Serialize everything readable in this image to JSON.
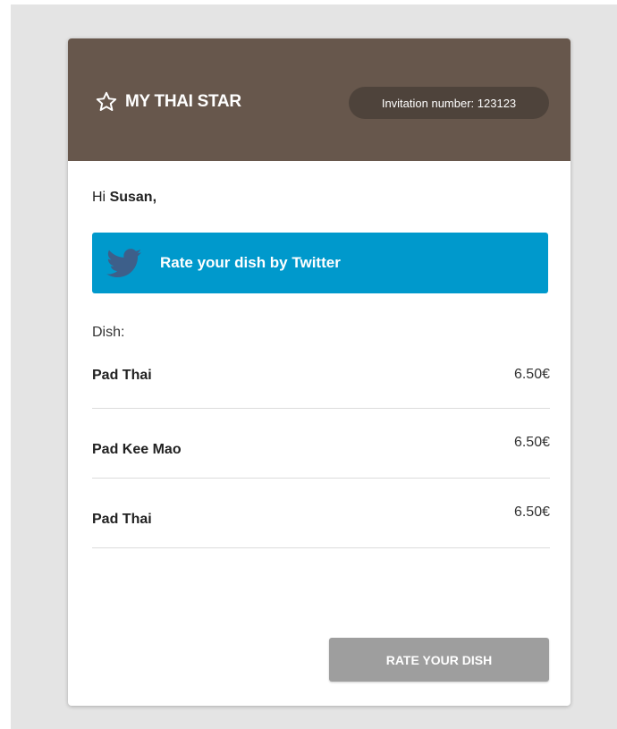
{
  "header": {
    "brand": "MY THAI STAR",
    "invitation": "Invitation number: 123123"
  },
  "greeting": {
    "prefix": "Hi",
    "name": "Susan,"
  },
  "twitter": {
    "label": "Rate your dish by Twitter"
  },
  "dishes": {
    "label": "Dish:",
    "items": [
      {
        "name": "Pad Thai",
        "price": "6.50€"
      },
      {
        "name": "Pad Kee Mao",
        "price": "6.50€"
      },
      {
        "name": "Pad Thai",
        "price": "6.50€"
      }
    ]
  },
  "actions": {
    "rate": "RATE YOUR DISH"
  },
  "icons": {
    "brand": "star-outline-icon",
    "twitter": "twitter-bird-icon"
  },
  "colors": {
    "header": "#67574c",
    "invitation_pill": "#4e433b",
    "twitter": "#0099cc",
    "rate_button": "#9e9e9e",
    "backdrop": "#e4e4e4"
  }
}
